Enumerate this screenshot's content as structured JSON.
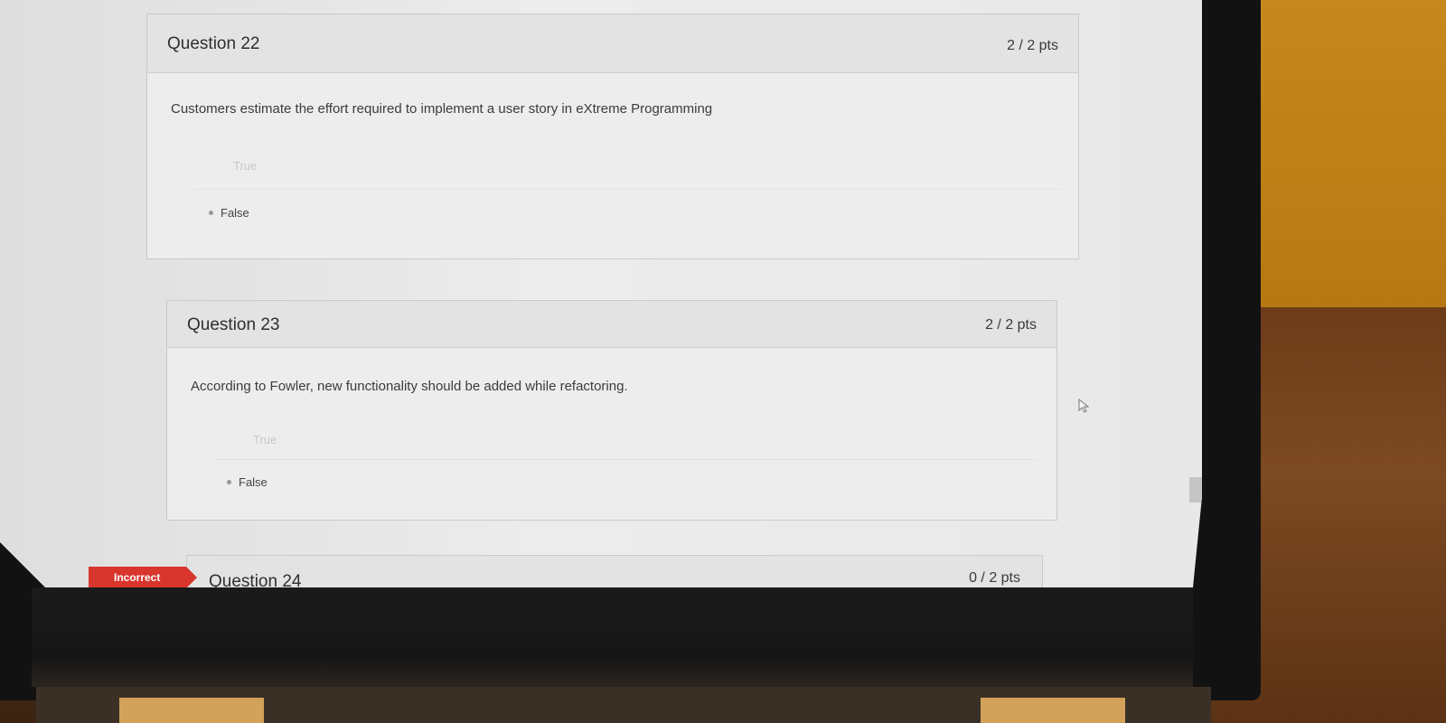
{
  "questions": [
    {
      "title": "Question 22",
      "points": "2 / 2 pts",
      "text": "Customers estimate the effort required to implement a user story in eXtreme Programming",
      "answers": [
        {
          "label": "True",
          "selected": false
        },
        {
          "label": "False",
          "selected": true
        }
      ]
    },
    {
      "title": "Question 23",
      "points": "2 / 2 pts",
      "text": "According to Fowler, new functionality should be added while refactoring.",
      "answers": [
        {
          "label": "True",
          "selected": false
        },
        {
          "label": "False",
          "selected": true
        }
      ]
    },
    {
      "title": "Question 24",
      "points": "0 / 2 pts",
      "status_badge": "Incorrect"
    }
  ],
  "icons": {
    "cursor": "mouse-pointer-icon"
  },
  "colors": {
    "incorrect_badge": "#d8352d"
  }
}
